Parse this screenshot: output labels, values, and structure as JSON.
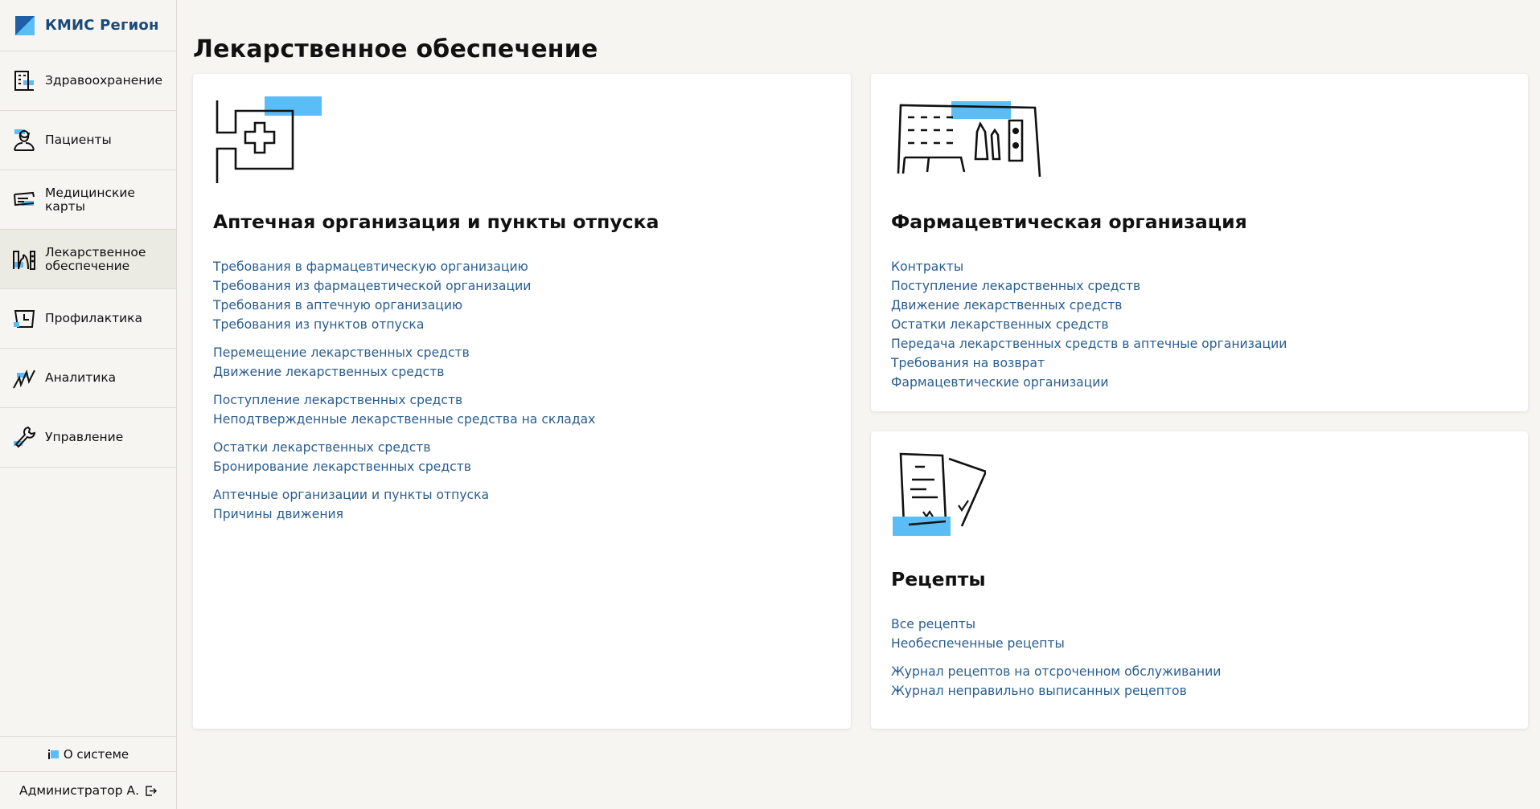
{
  "app": {
    "title": "КМИС Регион"
  },
  "sidebar": {
    "items": [
      {
        "label": "Здравоохранение",
        "icon": "hospital-building-icon",
        "active": false
      },
      {
        "label": "Пациенты",
        "icon": "patient-person-icon",
        "active": false
      },
      {
        "label": "Медицинские\nкарты",
        "icon": "medical-card-icon",
        "active": false
      },
      {
        "label": "Лекарственное\nобеспечение",
        "icon": "pharmacy-icon",
        "active": true
      },
      {
        "label": "Профилактика",
        "icon": "prevention-clock-icon",
        "active": false
      },
      {
        "label": "Аналитика",
        "icon": "analytics-chart-icon",
        "active": false
      },
      {
        "label": "Управление",
        "icon": "wrench-icon",
        "active": false
      }
    ],
    "about_label": "О системе",
    "user_label": "Администратор А."
  },
  "page": {
    "title": "Лекарственное обеспечение"
  },
  "cards": {
    "pharmacy": {
      "title": "Аптечная организация и пункты отпуска",
      "groups": [
        [
          "Требования в фармацевтическую организацию",
          "Требования из фармацевтической организации",
          "Требования в аптечную организацию",
          "Требования из пунктов отпуска"
        ],
        [
          "Перемещение лекарственных средств",
          "Движение лекарственных средств"
        ],
        [
          "Поступление лекарственных средств",
          "Неподтвержденные лекарственные средства на складах"
        ],
        [
          "Остатки лекарственных средств",
          "Бронирование лекарственных средств"
        ],
        [
          "Аптечные организации и пункты отпуска",
          "Причины движения"
        ]
      ]
    },
    "pharma_org": {
      "title": "Фармацевтическая организация",
      "groups": [
        [
          "Контракты",
          "Поступление лекарственных средств",
          "Движение лекарственных средств",
          "Остатки лекарственных средств",
          "Передача лекарственных средств в аптечные организации",
          "Требования на возврат",
          "Фармацевтические организации"
        ]
      ]
    },
    "recipes": {
      "title": "Рецепты",
      "groups": [
        [
          "Все рецепты",
          "Необеспеченные рецепты"
        ],
        [
          "Журнал рецептов на отсроченном обслуживании",
          "Журнал неправильно выписанных рецептов"
        ]
      ]
    }
  },
  "colors": {
    "accent": "#5bbdf5",
    "link": "#2a5d8f",
    "brand": "#1a4a7a",
    "background": "#f6f5f1"
  }
}
